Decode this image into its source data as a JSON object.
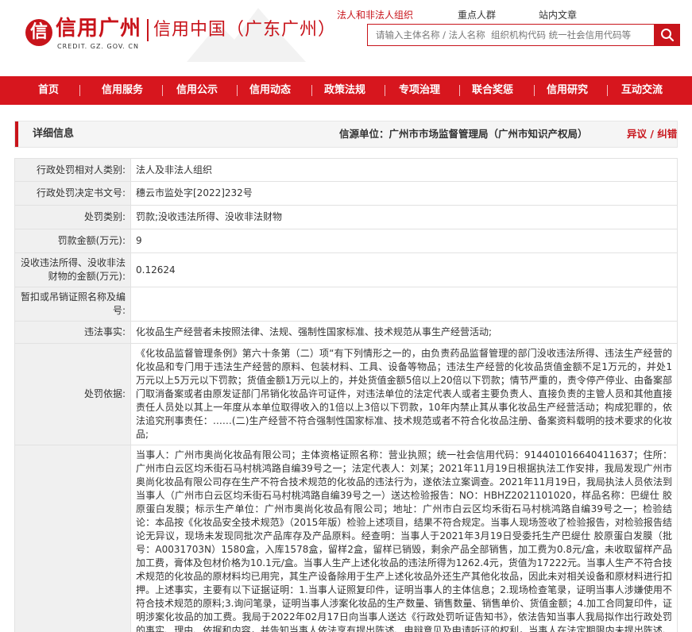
{
  "header": {
    "logo_brand": "信用广州",
    "logo_domain": "CREDIT. GZ. GOV. CN",
    "logo_title": "信用中国（广东广州）",
    "top_links": [
      "法人和非法人组织",
      "重点人群",
      "站内文章"
    ],
    "search_placeholder": "请输入主体名称 / 法人名称  组织机构代码 统一社会信用代码等"
  },
  "nav": {
    "items": [
      "首页",
      "信用服务",
      "信用公示",
      "信用动态",
      "政策法规",
      "专项治理",
      "联合奖惩",
      "信用研究",
      "互动交流"
    ]
  },
  "detail": {
    "title": "详细信息",
    "source_label": "信源单位：",
    "source_value": "广州市市场监督管理局（广州市知识产权局）",
    "report_label": "异议 / 纠错"
  },
  "colors": {
    "brand_red": "#c8141b",
    "nav_red": "#d7161e",
    "label_bg": "#f0f0f0"
  },
  "rows": [
    {
      "label": "行政处罚相对人类别:",
      "value": "法人及非法人组织"
    },
    {
      "label": "行政处罚决定书文号:",
      "value": "穗云市监处字[2022]232号"
    },
    {
      "label": "处罚类别:",
      "value": "罚款;没收违法所得、没收非法财物"
    },
    {
      "label": "罚款金额(万元):",
      "value": "9"
    },
    {
      "label": "没收违法所得、没收非法财物的金额(万元):",
      "value": "0.12624"
    },
    {
      "label": "暂扣或吊销证照名称及编号:",
      "value": ""
    },
    {
      "label": "违法事实:",
      "value": "化妆品生产经营者未按照法律、法规、强制性国家标准、技术规范从事生产经营活动;"
    },
    {
      "label": "处罚依据:",
      "value": "《化妆品监督管理条例》第六十条第（二）项“有下列情形之一的，由负责药品监督管理的部门没收违法所得、违法生产经营的化妆品和专门用于违法生产经营的原料、包装材料、工具、设备等物品；违法生产经营的化妆品货值金额不足1万元的，并处1万元以上5万元以下罚款；货值金额1万元以上的，并处货值金额5倍以上20倍以下罚款；情节严重的，责令停产停业、由备案部门取消备案或者由原发证部门吊销化妆品许可证件，对违法单位的法定代表人或者主要负责人、直接负责的主管人员和其他直接责任人员处以其上一年度从本单位取得收入的1倍以上3倍以下罚款，10年内禁止其从事化妆品生产经营活动；构成犯罪的，依法追究刑事责任：……(二)生产经营不符合强制性国家标准、技术规范或者不符合化妆品注册、备案资料载明的技术要求的化妆品;"
    },
    {
      "label": "",
      "value": "当事人：广州市奥尚化妆品有限公司；主体资格证照名称：营业执照；统一社会信用代码：914401016640411637；住所：广州市白云区均禾街石马村桃鸿路自编39号之一；法定代表人：刘某；2021年11月19日根据执法工作安排，我局发现广州市奥尚化妆品有限公司存在生产不符合技术规范的化妆品的违法行为，遂依法立案调查。2021年11月19日，我局执法人员依法到当事人（广州市白云区均禾街石马村桃鸿路自编39号之一）送达检验报告：NO：HBHZ2021101020，样品名称：巴缇仕 胶原蛋白发膜；标示生产单位：广州市奥尚化妆品有限公司；地址：广州市白云区均禾街石马村桃鸿路自编39号之一；检验结论：本品按《化妆品安全技术规范》（2015年版）检验上述项目，结果不符合规定。当事人现场签收了检验报告，对检验报告结论无异议，现场未发现同批次产品库存及产品原料。经查明：当事人于2021年3月19日受委托生产巴缇仕 胶原蛋白发膜（批号：A0031703N）1580盒，入库1578盒，留样2盒，留样已销毁，剩余产品全部销售，加工费为0.8元/盒，未收取留样产品加工费，膏体及包材价格为10.1元/盒。当事人生产上述化妆品的违法所得为1262.4元，货值为17222元。当事人生产不符合技术规范的化妆品的原材料均已用完，其生产设备除用于生产上述化妆品外还生产其他化妆品，因此未对相关设备和原材料进行扣押。上述事实，主要有以下证据证明：1.当事人证照复印件，证明当事人的主体信息；2.现场检查笔录，证明当事人涉嫌使用不符合技术规范的原料;3.询问笔录，证明当事人涉案化妆品的生产数量、销售数量、销售单价、货值金额；4.加工合同复印件，证明涉案化妆品的加工费。我局于2022年02月17日向当事人送达《行政处罚听证告知书》，依法告知当事人我局拟作出行政处罚的事实、理由、依据和内容，并告知当事人依法享有提出陈述、申辩意见及申请听证的权利，当事人在法定期限内未提出陈述、申辩意见，也未提出听证申请。当事"
    }
  ]
}
